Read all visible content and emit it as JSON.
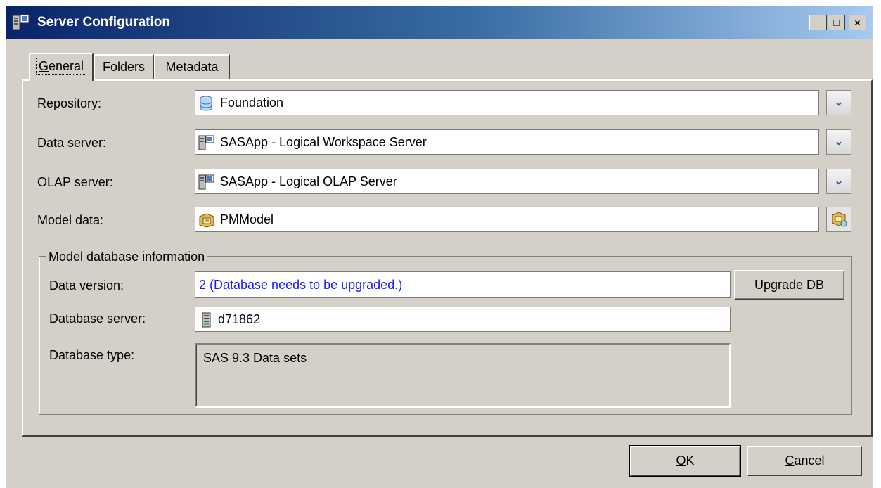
{
  "window": {
    "title": "Server Configuration",
    "minimize": "_",
    "maximize": "□",
    "close": "×"
  },
  "tabs": [
    {
      "label": "General",
      "mnemonic": "G",
      "rest": "eneral"
    },
    {
      "label": "Folders",
      "mnemonic": "F",
      "rest": "olders"
    },
    {
      "label": "Metadata",
      "mnemonic": "M",
      "rest": "etadata"
    }
  ],
  "form": {
    "repository": {
      "label": "Repository:",
      "value": "Foundation",
      "icon": "database-icon"
    },
    "data_server": {
      "label": "Data server:",
      "value": "SASApp - Logical Workspace Server",
      "icon": "server-icon"
    },
    "olap_server": {
      "label": "OLAP server:",
      "value": "SASApp - Logical OLAP Server",
      "icon": "server-icon"
    },
    "model_data": {
      "label": "Model data:",
      "value": "PMModel",
      "icon": "model-icon"
    }
  },
  "model_db": {
    "title": "Model database information",
    "data_version_label": "Data version:",
    "data_version_value": "2 (Database needs to be upgraded.)",
    "upgrade_button_pre": "U",
    "upgrade_button_rest": "pgrade DB",
    "db_server_label": "Database server:",
    "db_server_value": "d71862",
    "db_type_label": "Database type:",
    "db_type_value": "SAS 9.3 Data sets"
  },
  "buttons": {
    "ok_mnemonic": "O",
    "ok_rest": "K",
    "cancel_mnemonic": "C",
    "cancel_rest": "ancel"
  },
  "colors": {
    "title_start": "#0a246a",
    "title_end": "#a6caf0",
    "face": "#d4d0c8",
    "link_value": "#1a1aff"
  }
}
